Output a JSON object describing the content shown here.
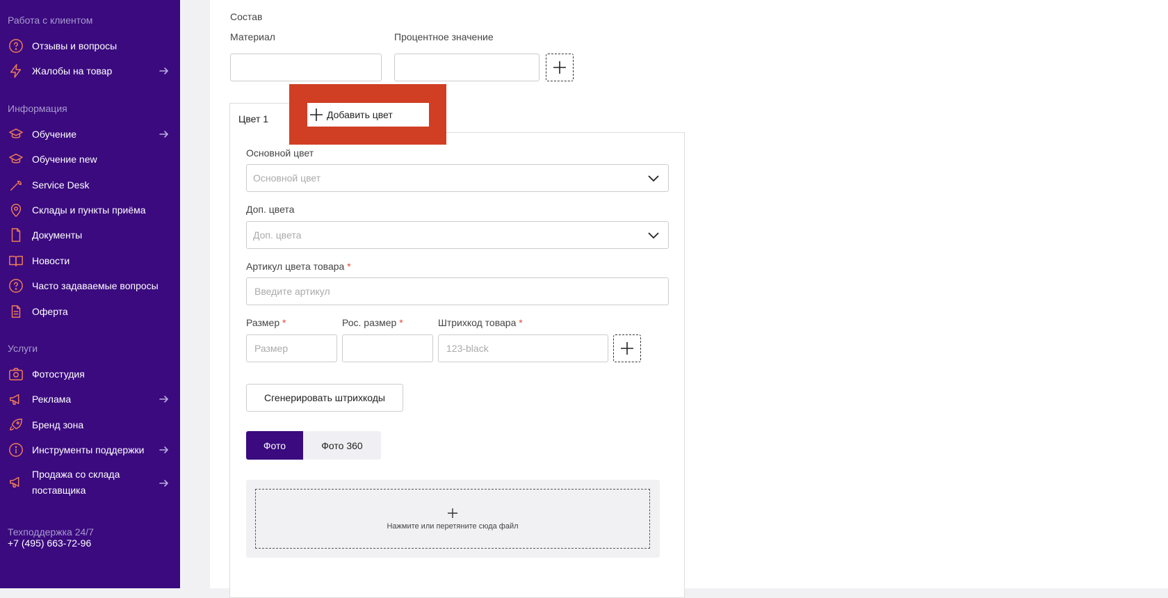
{
  "sidebar": {
    "sections": [
      {
        "title": "Работа с клиентом"
      },
      {
        "title": "Информация"
      },
      {
        "title": "Услуги"
      }
    ],
    "items": [
      {
        "label": "Отзывы и вопросы",
        "icon": "question-circle-icon",
        "arrow": false
      },
      {
        "label": "Жалобы на товар",
        "icon": "lightning-icon",
        "arrow": true
      },
      {
        "label": "Обучение",
        "icon": "graduation-cap-icon",
        "arrow": true
      },
      {
        "label": "Обучение new",
        "icon": "graduation-cap-icon",
        "arrow": false
      },
      {
        "label": "Service Desk",
        "icon": "wrench-icon",
        "arrow": false
      },
      {
        "label": "Склады и пункты приёма",
        "icon": "map-pin-icon",
        "arrow": false
      },
      {
        "label": "Документы",
        "icon": "document-icon",
        "arrow": false
      },
      {
        "label": "Новости",
        "icon": "book-icon",
        "arrow": false
      },
      {
        "label": "Часто задаваемые вопросы",
        "icon": "question-circle-icon",
        "arrow": false
      },
      {
        "label": "Оферта",
        "icon": "file-text-icon",
        "arrow": false
      },
      {
        "label": "Фотостудия",
        "icon": "camera-icon",
        "arrow": false
      },
      {
        "label": "Реклама",
        "icon": "megaphone-icon",
        "arrow": true
      },
      {
        "label": "Бренд зона",
        "icon": "rocket-icon",
        "arrow": false
      },
      {
        "label": "Инструменты поддержки",
        "icon": "info-circle-icon",
        "arrow": true
      },
      {
        "label": "Продажа со склада поставщика",
        "icon": "megaphone-icon",
        "arrow": true
      }
    ],
    "support_label": "Техподдержка 24/7",
    "support_phone": "+7 (495) 663-72-96"
  },
  "composition": {
    "title": "Состав",
    "material_label": "Материал",
    "percent_label": "Процентное значение",
    "material_value": "",
    "percent_value": ""
  },
  "color_tabs": {
    "active_tab": "Цвет 1",
    "add_color_label": "Добавить цвет"
  },
  "form": {
    "main_color_label": "Основной цвет",
    "main_color_placeholder": "Основной цвет",
    "extra_colors_label": "Доп. цвета",
    "extra_colors_placeholder": "Доп. цвета",
    "article_label": "Артикул цвета товара",
    "article_placeholder": "Введите артикул",
    "size_label": "Размер",
    "size_placeholder": "Размер",
    "ru_size_label": "Рос. размер",
    "ru_size_placeholder": "",
    "barcode_label": "Штрихкод товара",
    "barcode_placeholder": "123-black",
    "required_mark": "*",
    "generate_barcodes_label": "Сгенерировать штрихкоды"
  },
  "media": {
    "photo_tab": "Фото",
    "photo360_tab": "Фото 360",
    "dropzone_text": "Нажмите или перетяните сюда файл"
  },
  "colors": {
    "sidebar_bg": "#3a0a7e",
    "icon_accent": "#f07c58",
    "highlight": "#d03e24",
    "required": "#e0483e"
  }
}
